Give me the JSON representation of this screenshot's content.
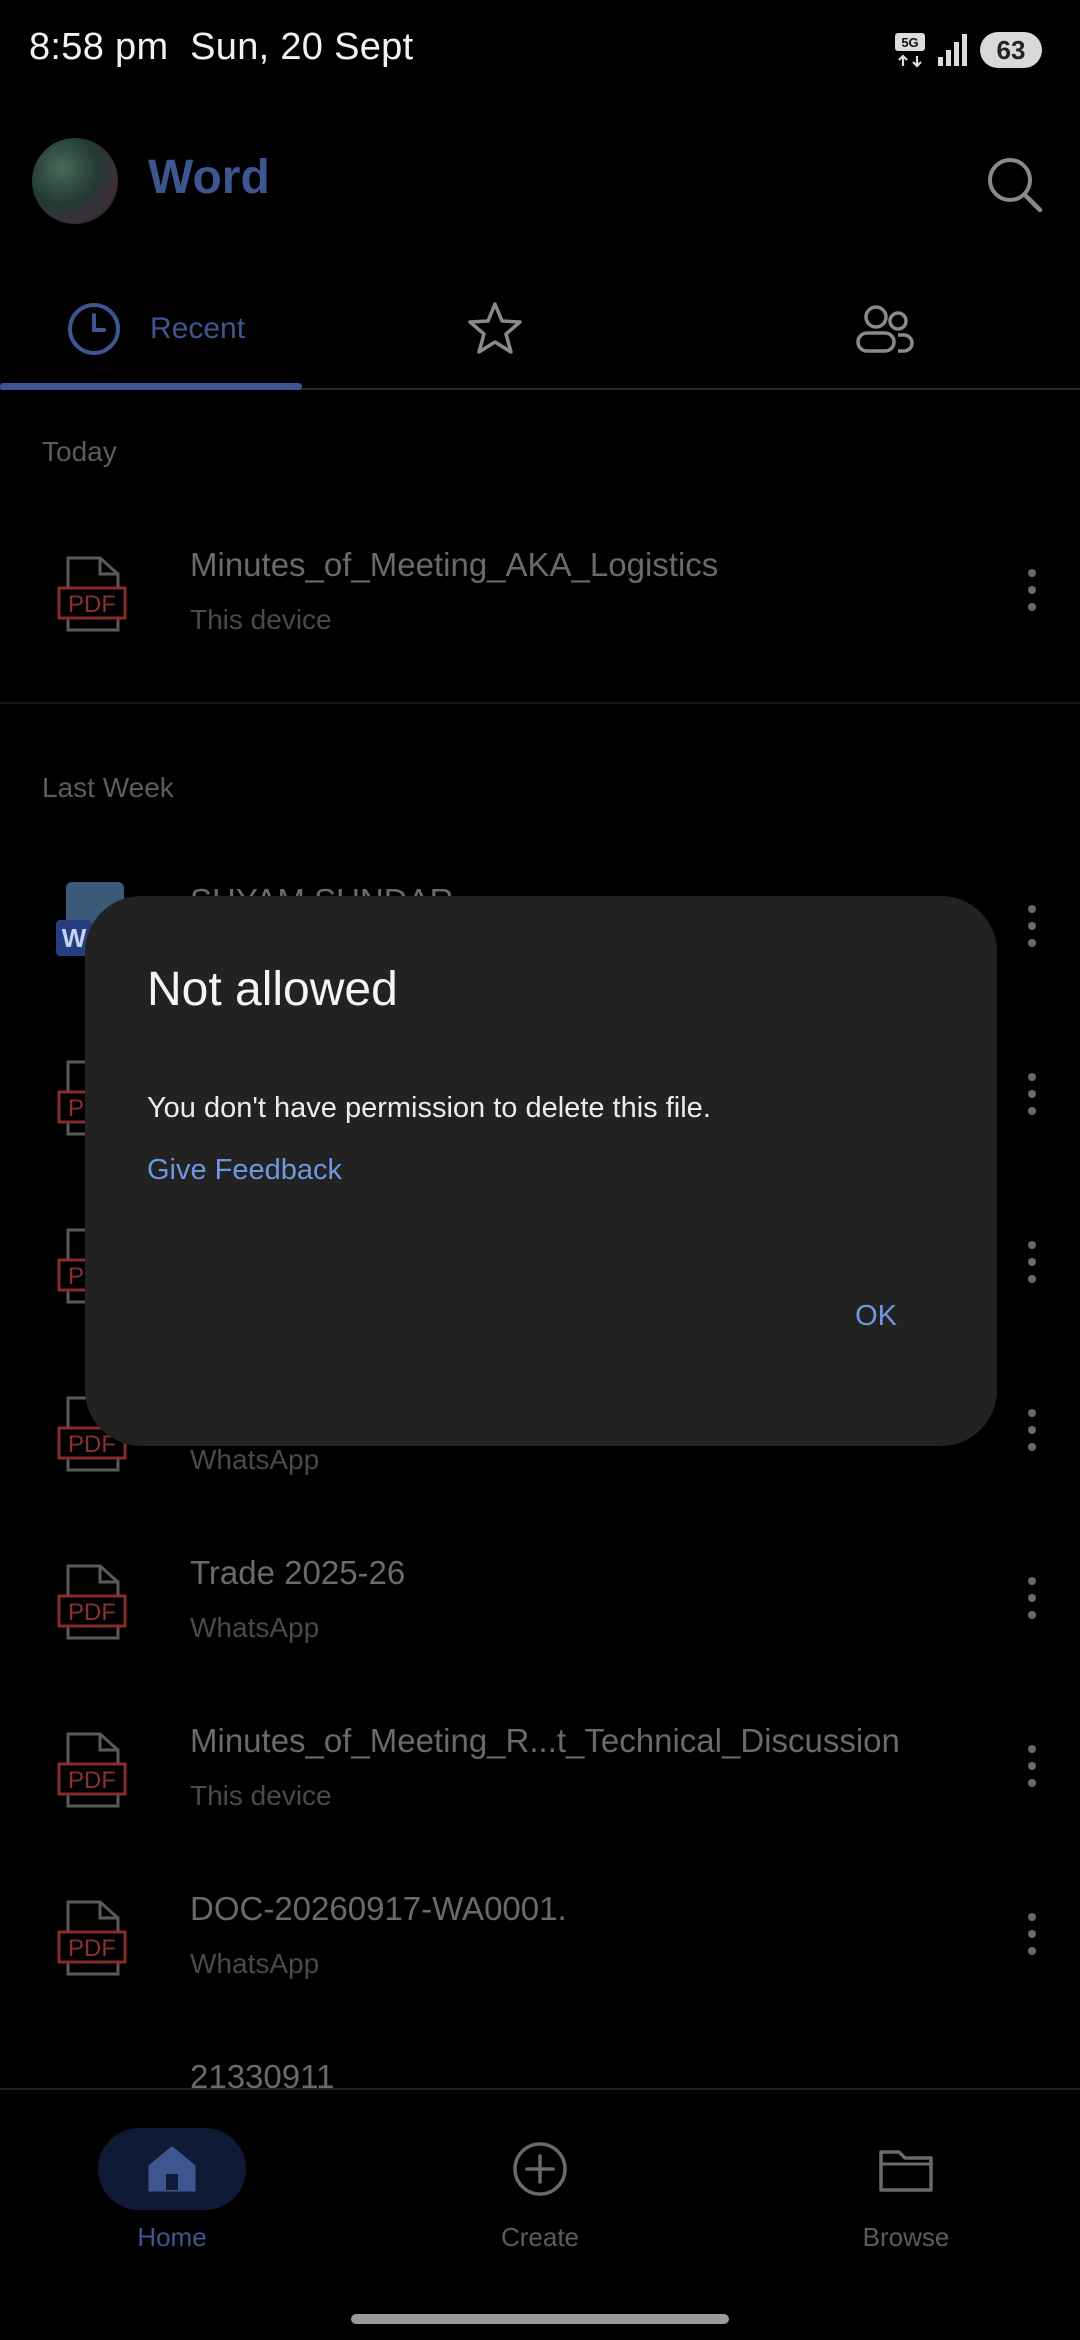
{
  "status_bar": {
    "time": "8:58 pm",
    "date": "Sun, 20 Sept",
    "network": "5G",
    "battery": "63"
  },
  "app_bar": {
    "title": "Word",
    "search_icon": "search-icon",
    "avatar": "profile-avatar"
  },
  "tabs": [
    {
      "label": "Recent",
      "icon": "clock-icon",
      "selected": true
    },
    {
      "label": "",
      "icon": "star-icon",
      "selected": false
    },
    {
      "label": "",
      "icon": "people-icon",
      "selected": false
    }
  ],
  "sections": {
    "today": "Today",
    "last_week": "Last Week"
  },
  "files": [
    {
      "name": "Minutes_of_Meeting_AKA_Logistics",
      "location": "This device",
      "type": "PDF"
    },
    {
      "name": "SHYAM SUNDAR",
      "location": "",
      "type": "W"
    },
    {
      "name": "",
      "location": "",
      "type": "PDF"
    },
    {
      "name": "",
      "location": "",
      "type": "PDF"
    },
    {
      "name": "",
      "location": "WhatsApp",
      "type": "PDF"
    },
    {
      "name": "Trade 2025-26",
      "location": "WhatsApp",
      "type": "PDF"
    },
    {
      "name": "Minutes_of_Meeting_R...t_Technical_Discussion",
      "location": "This device",
      "type": "PDF"
    },
    {
      "name": "DOC-20260917-WA0001.",
      "location": "WhatsApp",
      "type": "PDF"
    },
    {
      "name": "21330911",
      "location": "",
      "type": "PDF"
    }
  ],
  "bottom_nav": {
    "home": "Home",
    "create": "Create",
    "browse": "Browse"
  },
  "dialog": {
    "title": "Not allowed",
    "message": "You don't have permission to delete this file.",
    "feedback_link": "Give Feedback",
    "ok_label": "OK"
  },
  "colors": {
    "accent": "#3e5690",
    "dialog_bg": "#222222",
    "link": "#6d97e0",
    "pdf_red": "#8a2b2b"
  }
}
